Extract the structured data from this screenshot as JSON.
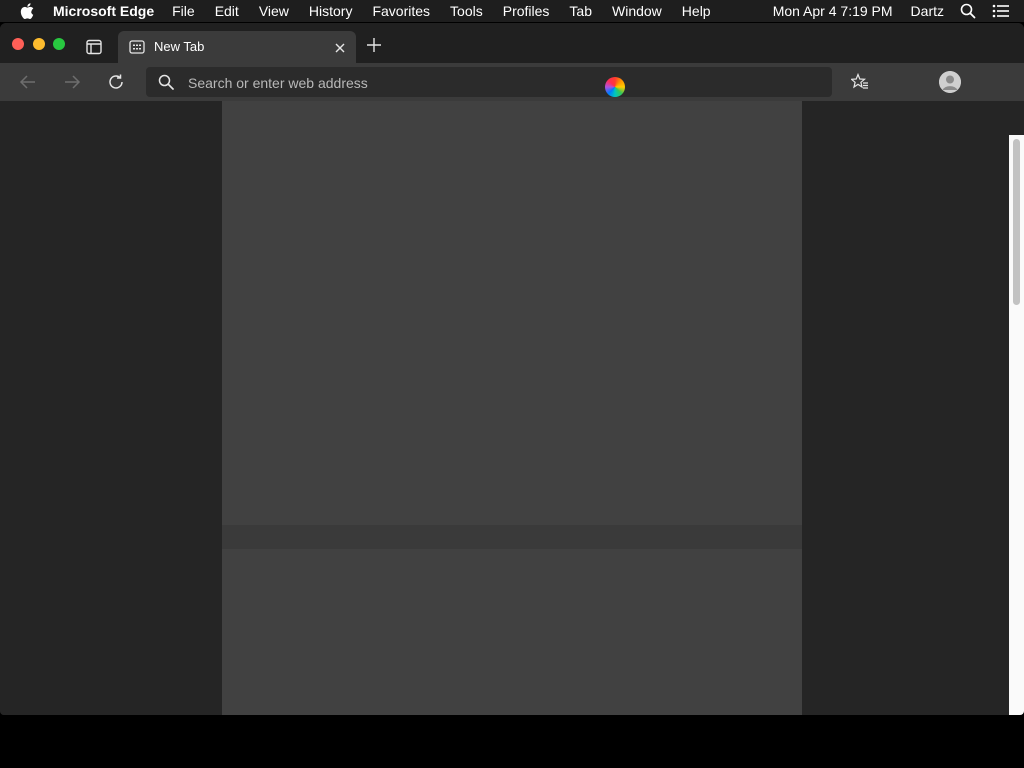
{
  "menubar": {
    "app_name": "Microsoft Edge",
    "items": [
      "File",
      "Edit",
      "View",
      "History",
      "Favorites",
      "Tools",
      "Profiles",
      "Tab",
      "Window",
      "Help"
    ],
    "clock": "Mon Apr 4  7:19 PM",
    "user": "Dartz"
  },
  "tab": {
    "title": "New Tab"
  },
  "address_bar": {
    "placeholder": "Search or enter web address",
    "value": ""
  },
  "icons": {
    "apple": "apple-icon",
    "spotlight": "search-icon",
    "control_center": "list-icon",
    "tab_actions": "tab-actions-icon",
    "favicon": "new-tab-page-icon",
    "tab_close": "close-icon",
    "new_tab": "plus-icon",
    "back": "arrow-left-icon",
    "forward": "arrow-right-icon",
    "reload": "reload-icon",
    "address_search": "search-icon",
    "favorites": "favorites-star-icon",
    "profile": "profile-icon"
  },
  "colors": {
    "window_close": "#fe5f57",
    "window_minimize": "#febc2e",
    "window_maximize": "#28c840",
    "toolbar": "#3b3b3b",
    "content_background": "#252525",
    "panel": "#414141"
  }
}
